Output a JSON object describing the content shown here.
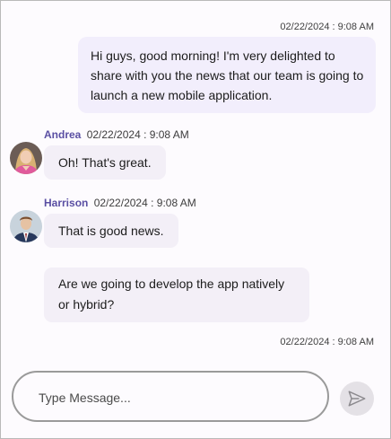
{
  "messages": [
    {
      "timestamp": "02/22/2024 : 9:08 AM",
      "text": "Hi guys, good morning! I'm very delighted to share with you the news that our team is going to launch a new mobile application."
    },
    {
      "author": "Andrea",
      "timestamp": "02/22/2024 : 9:08 AM",
      "text": "Oh! That's great."
    },
    {
      "author": "Harrison",
      "timestamp": "02/22/2024 : 9:08 AM",
      "text": "That is good news."
    },
    {
      "text": "Are we going to develop the app natively or hybrid?",
      "timestamp": "02/22/2024 : 9:08 AM"
    }
  ],
  "composer": {
    "placeholder": "Type Message..."
  },
  "icons": {
    "send": "send-icon"
  },
  "colors": {
    "outgoing_bubble": "#f2eefc",
    "incoming_bubble": "#f3eff7",
    "author_name": "#5a4fa3",
    "send_button": "#e4e1e6"
  }
}
